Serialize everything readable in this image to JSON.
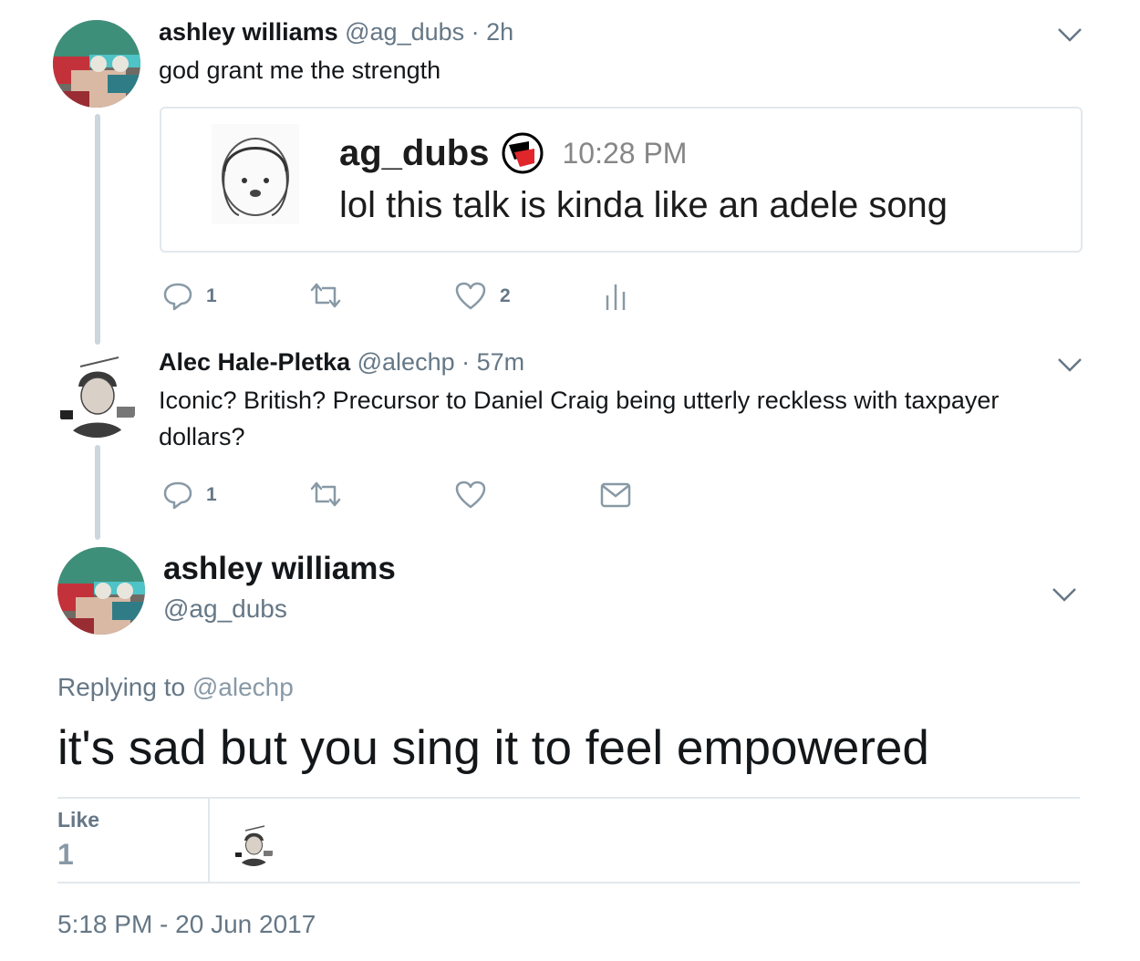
{
  "tweets": [
    {
      "name": "ashley williams",
      "meta": "@ag_dubs · 2h",
      "text": "god grant me the strength",
      "quote": {
        "username": "ag_dubs",
        "time": "10:28 PM",
        "text": "lol this talk is kinda like an adele song"
      },
      "actions": {
        "reply_count": "1",
        "retweet_count": "",
        "like_count": "2"
      }
    },
    {
      "name": "Alec Hale-Pletka",
      "meta": "@alechp · 57m",
      "text_line1": "Iconic? British? Precursor to Daniel Craig being utterly reckless with taxpayer",
      "text_line2": "dollars?",
      "actions": {
        "reply_count": "1",
        "retweet_count": "",
        "like_count": ""
      }
    }
  ],
  "main_tweet": {
    "name": "ashley williams",
    "handle": "@ag_dubs",
    "replying_label": "Replying to",
    "replying_handle": "@alechp",
    "text": "it's sad but you sing it to feel empowered",
    "likes_label": "Like",
    "likes_count": "1",
    "timestamp": "5:18 PM - 20 Jun 2017"
  },
  "colors": {
    "text": "#14171a",
    "secondary": "#657786",
    "border": "#e1e8ed",
    "thread_line": "#ccd6dd",
    "icon": "#8899a6",
    "antifa_red": "#e0262b"
  },
  "icons": [
    "reply-icon",
    "retweet-icon",
    "heart-icon",
    "analytics-icon",
    "mail-icon",
    "chevron-down-icon",
    "antifa-flag-icon"
  ]
}
